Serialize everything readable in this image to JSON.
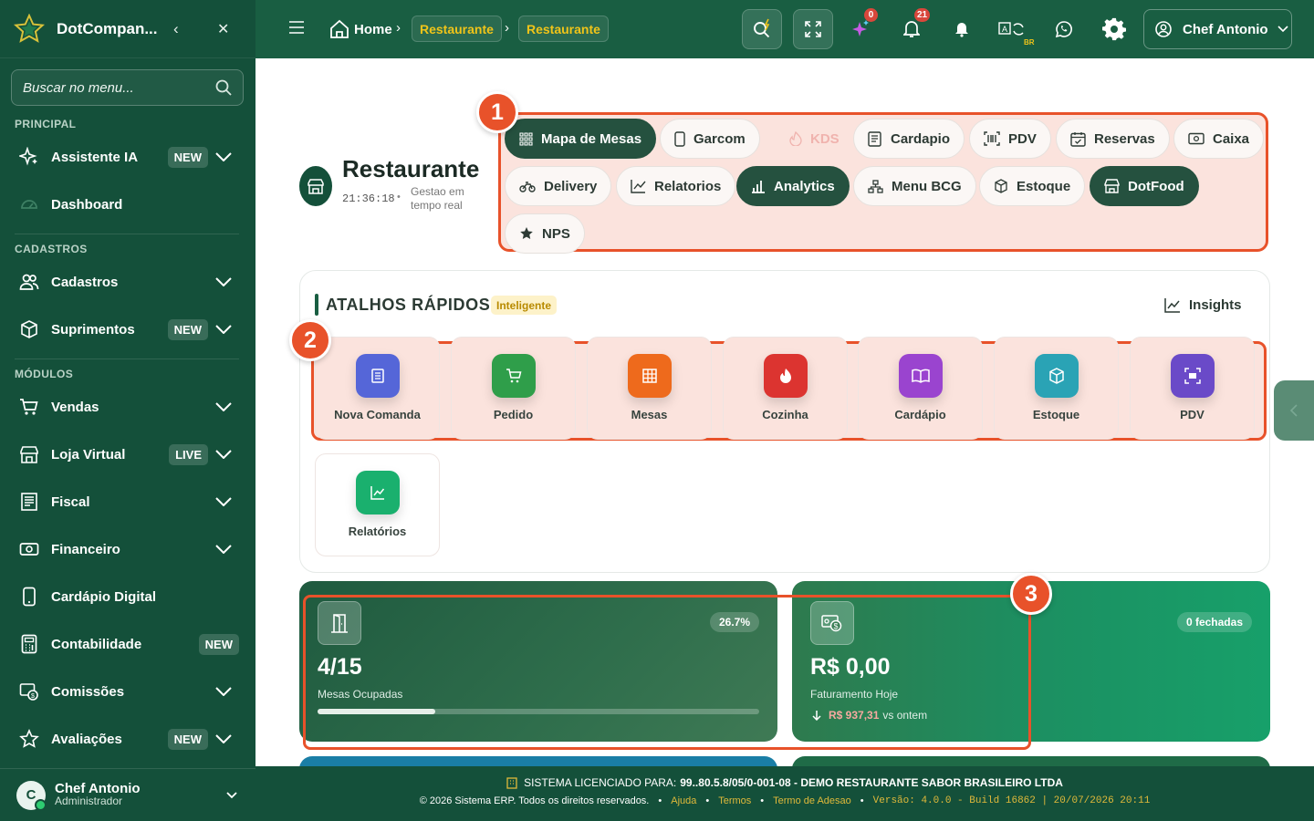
{
  "brand": {
    "name": "DotCompan..."
  },
  "search": {
    "placeholder": "Buscar no menu..."
  },
  "sidebar": {
    "sections": [
      "PRINCIPAL",
      "CADASTROS",
      "MÓDULOS"
    ],
    "items": [
      {
        "label": "Assistente IA",
        "badge": "NEW"
      },
      {
        "label": "Dashboard",
        "badge": ""
      },
      {
        "label": "Cadastros",
        "badge": ""
      },
      {
        "label": "Suprimentos",
        "badge": "NEW"
      },
      {
        "label": "Vendas",
        "badge": ""
      },
      {
        "label": "Loja Virtual",
        "badge": "LIVE"
      },
      {
        "label": "Fiscal",
        "badge": ""
      },
      {
        "label": "Financeiro",
        "badge": ""
      },
      {
        "label": "Cardápio Digital",
        "badge": ""
      },
      {
        "label": "Contabilidade",
        "badge": "NEW"
      },
      {
        "label": "Comissões",
        "badge": ""
      },
      {
        "label": "Avaliações",
        "badge": "NEW"
      }
    ],
    "user": {
      "initial": "C",
      "name": "Chef Antonio",
      "role": "Administrador"
    }
  },
  "topbar": {
    "breadcrumb": [
      "Home",
      "Restaurante",
      "Restaurante"
    ],
    "counts": {
      "ai": "0",
      "notifications": "21"
    },
    "lang_badge": "BR",
    "user_label": "Chef Antonio"
  },
  "page": {
    "title": "Restaurante",
    "time": "21:36:18",
    "subtitle": "Gestao em tempo real"
  },
  "tabs": [
    "Mapa de Mesas",
    "Garcom",
    "KDS",
    "Cardapio",
    "PDV",
    "Reservas",
    "Caixa",
    "Delivery",
    "Relatorios",
    "Analytics",
    "Menu BCG",
    "Estoque",
    "DotFood",
    "NPS"
  ],
  "shortcuts": {
    "title": "ATALHOS RÁPIDOS",
    "tag": "Inteligente",
    "insights": "Insights",
    "items": [
      {
        "label": "Nova Comanda",
        "color": "#5566d8"
      },
      {
        "label": "Pedido",
        "color": "#2f9e4a"
      },
      {
        "label": "Mesas",
        "color": "#ee6a1c"
      },
      {
        "label": "Cozinha",
        "color": "#dc3430"
      },
      {
        "label": "Cardápio",
        "color": "#9a44cf"
      },
      {
        "label": "Estoque",
        "color": "#2aa3b5"
      },
      {
        "label": "PDV",
        "color": "#6a4ac8"
      },
      {
        "label": "Relatórios",
        "color": "#1ab06e"
      }
    ]
  },
  "stats": {
    "tables": {
      "value": "4/15",
      "label": "Mesas Ocupadas",
      "percent_label": "26.7%",
      "occupancy": 0.267
    },
    "revenue": {
      "value": "R$ 0,00",
      "label": "Faturamento Hoje",
      "yesterday": "R$ 937,31",
      "vs": "vs ontem",
      "closed": "0 fechadas"
    }
  },
  "markers": [
    "1",
    "2",
    "3"
  ],
  "footer": {
    "license_prefix": "SISTEMA LICENCIADO PARA:",
    "license": "99..80.5.8/05/0-001-08 - DEMO RESTAURANTE SABOR BRASILEIRO LTDA",
    "copyright": "© 2026 Sistema ERP. Todos os direitos reservados.",
    "links": [
      "Ajuda",
      "Termos",
      "Termo de Adesao"
    ],
    "version": "Versão: 4.0.0 - Build 16862 | 20/07/2026 20:11"
  }
}
